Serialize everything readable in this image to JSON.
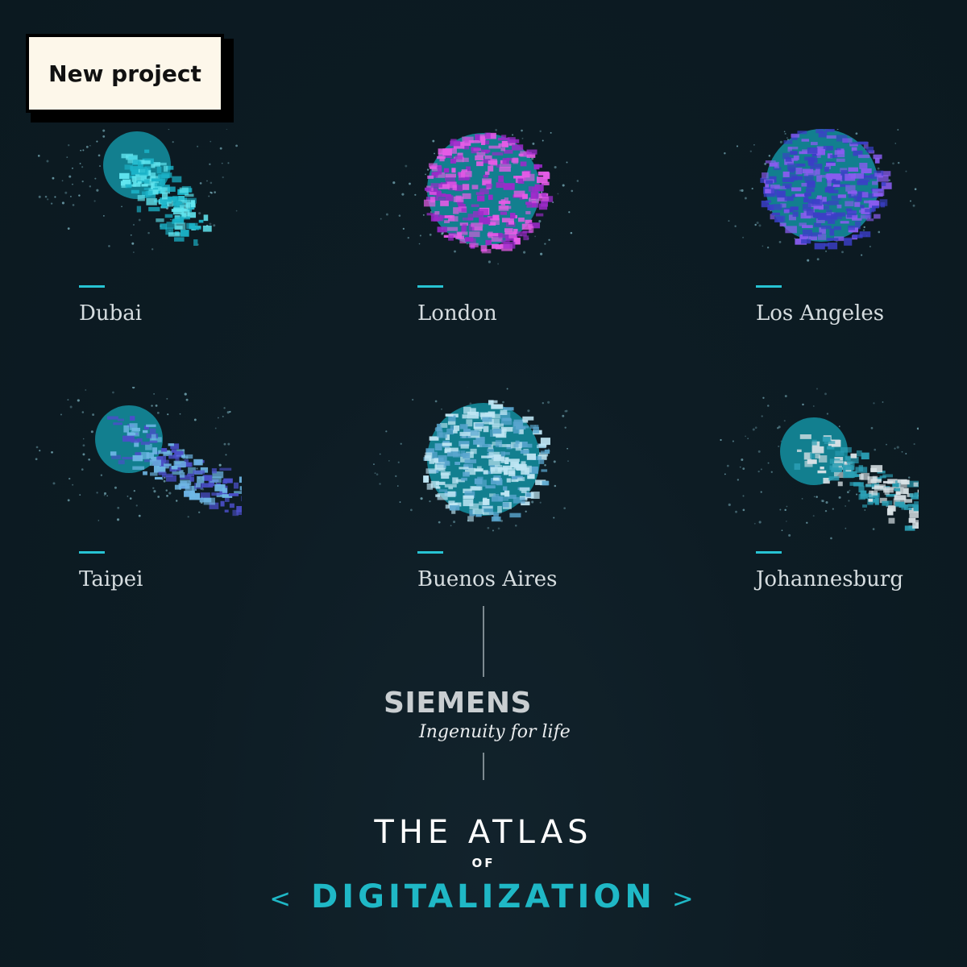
{
  "badge": {
    "label": "New project"
  },
  "cities": [
    {
      "name": "Dubai",
      "c1": "#1bb3c8",
      "c2": "#62e6f0",
      "style": "tail"
    },
    {
      "name": "London",
      "c1": "#9b2ac9",
      "c2": "#e55ce6",
      "style": "full"
    },
    {
      "name": "Los Angeles",
      "c1": "#3b3fc7",
      "c2": "#8a5cf0",
      "style": "full"
    },
    {
      "name": "Taipei",
      "c1": "#4b4fc9",
      "c2": "#6fb8e6",
      "style": "tail"
    },
    {
      "name": "Buenos Aires",
      "c1": "#5aa6cf",
      "c2": "#bfe6f4",
      "style": "full"
    },
    {
      "name": "Johannesburg",
      "c1": "#2b9fb5",
      "c2": "#d9e2e6",
      "style": "tail"
    }
  ],
  "brand": {
    "logo": "SIEMENS",
    "tagline": "Ingenuity for life"
  },
  "title": {
    "line1": "THE ATLAS",
    "of": "OF",
    "open": "<",
    "main": "DIGITALIZATION",
    "close": ">"
  }
}
